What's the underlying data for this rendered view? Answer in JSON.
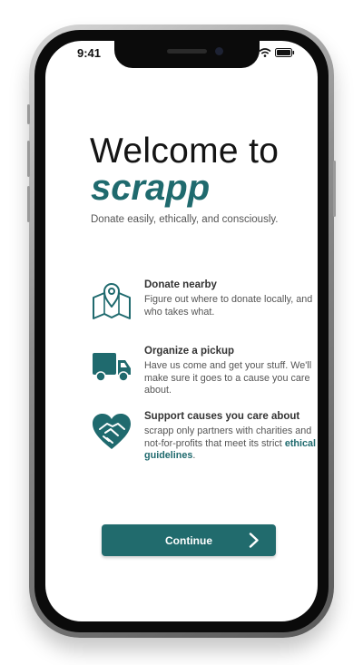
{
  "status_bar": {
    "time": "9:41"
  },
  "welcome": {
    "heading": "Welcome to",
    "brand": "scrapp",
    "tagline": "Donate easily, ethically, and consciously."
  },
  "features": [
    {
      "title": "Donate nearby",
      "description": "Figure out where to donate locally, and who takes what.",
      "icon": "map-pin-icon"
    },
    {
      "title": "Organize a pickup",
      "description": "Have us come and get your stuff. We'll make sure it goes to a cause you care about.",
      "icon": "delivery-truck-icon"
    },
    {
      "title": "Support  causes you care about",
      "description_before_link": "scrapp only partners with charities and not-for-profits that meet its strict ",
      "link_text": "ethical guidelines",
      "description_after_link": ".",
      "icon": "heart-handshake-icon"
    }
  ],
  "continue_button": {
    "label": "Continue"
  },
  "colors": {
    "brand": "#1f6a6e",
    "button": "#216b6d",
    "text_dark": "#141414",
    "text_muted": "#555555"
  }
}
